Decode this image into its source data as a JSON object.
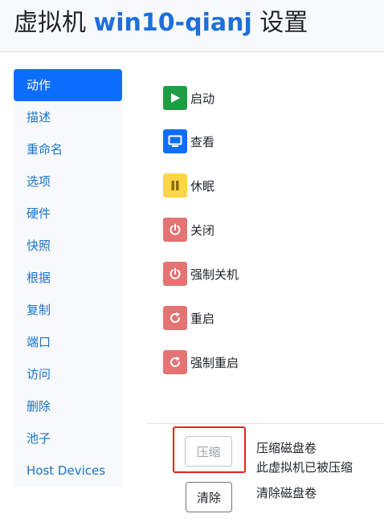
{
  "title": {
    "prefix": "虚拟机",
    "vm_name": "win10-qianj",
    "suffix": "设置"
  },
  "sidebar": {
    "items": [
      {
        "label": "动作",
        "active": true
      },
      {
        "label": "描述"
      },
      {
        "label": "重命名"
      },
      {
        "label": "选项"
      },
      {
        "label": "硬件"
      },
      {
        "label": "快照"
      },
      {
        "label": "根据"
      },
      {
        "label": "复制"
      },
      {
        "label": "端口"
      },
      {
        "label": "访问"
      },
      {
        "label": "删除"
      },
      {
        "label": "池子"
      },
      {
        "label": "Host Devices"
      }
    ]
  },
  "actions": [
    {
      "label": "启动",
      "icon": "play-icon",
      "color": "#1f9d45"
    },
    {
      "label": "查看",
      "icon": "monitor-icon",
      "color": "#0d6efd"
    },
    {
      "label": "休眠",
      "icon": "pause-icon",
      "color": "#ffd447"
    },
    {
      "label": "关闭",
      "icon": "power-icon",
      "color": "#e57373"
    },
    {
      "label": "强制关机",
      "icon": "power-icon",
      "color": "#e57373"
    },
    {
      "label": "重启",
      "icon": "restart-icon",
      "color": "#e57373"
    },
    {
      "label": "强制重启",
      "icon": "restart-icon",
      "color": "#e57373"
    }
  ],
  "disk": {
    "compress_button": "压缩",
    "compress_title": "压缩磁盘卷",
    "compress_note": "此虚拟机已被压缩",
    "clear_button": "清除",
    "clear_title": "清除磁盘卷"
  },
  "colors": {
    "accent": "#0d6efd",
    "link": "#1a73c8",
    "highlight": "#e8231c"
  }
}
